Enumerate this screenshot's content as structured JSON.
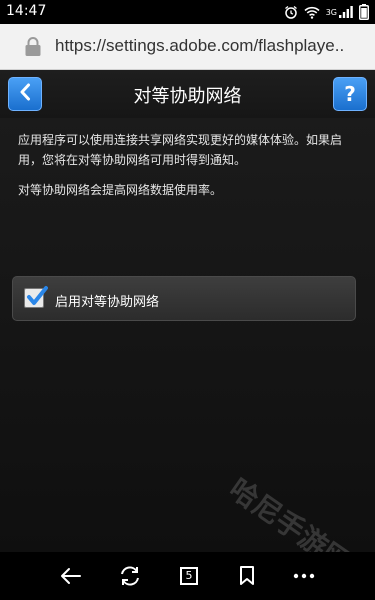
{
  "status_bar": {
    "time": "14:47",
    "network": "3G"
  },
  "browser": {
    "url": "https://settings.adobe.com/flashplaye.."
  },
  "header": {
    "title": "对等协助网络",
    "help_label": "?"
  },
  "content": {
    "paragraph1": "应用程序可以使用连接共享网络实现更好的媒体体验。如果启用，您将在对等协助网络可用时得到通知。",
    "paragraph2": "对等协助网络会提高网络数据使用率。",
    "option": {
      "label": "启用对等协助网络",
      "checked": true
    }
  },
  "nav": {
    "tab_count": "5"
  },
  "watermark": "哈尼手游网",
  "colors": {
    "accent": "#2a86e8",
    "background": "#111111"
  }
}
